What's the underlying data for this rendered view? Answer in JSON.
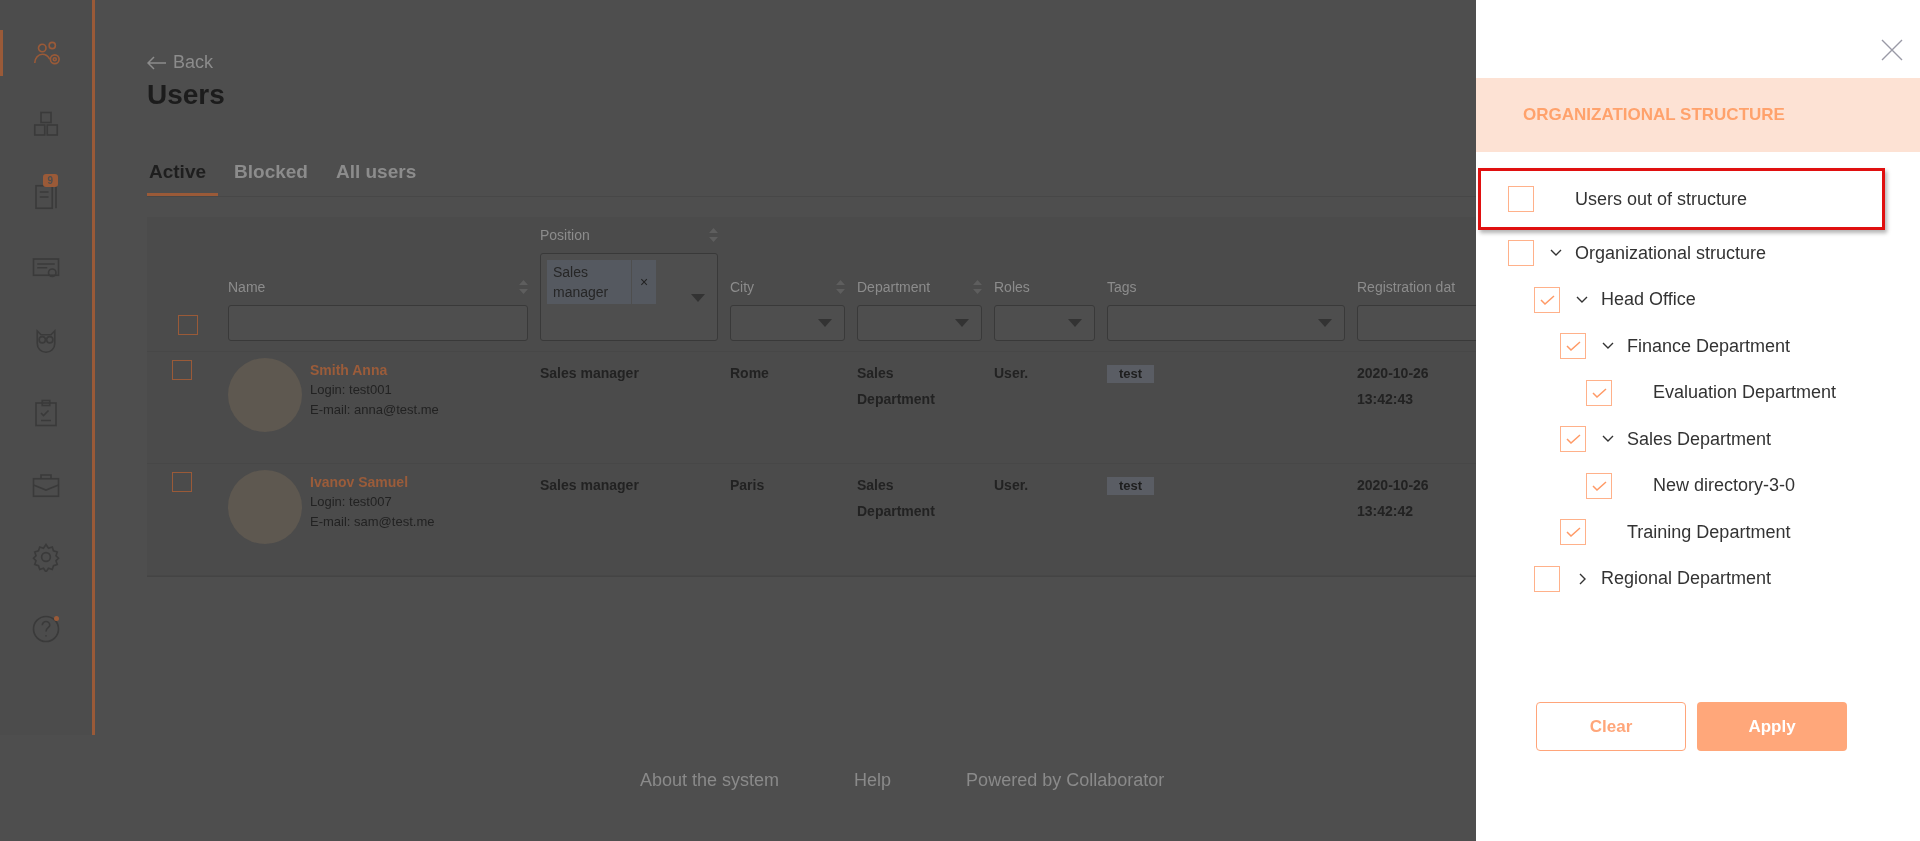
{
  "sidebar": {
    "items": [
      {
        "selected": true
      },
      {
        "selected": false
      },
      {
        "selected": false,
        "badge": "9"
      },
      {
        "selected": false
      },
      {
        "selected": false
      },
      {
        "selected": false
      },
      {
        "selected": false
      },
      {
        "selected": false
      },
      {
        "selected": false,
        "notification_dot": true
      }
    ]
  },
  "back_link": "Back",
  "title": "Users",
  "tabs": [
    {
      "label": "Active",
      "selected": true
    },
    {
      "label": "Blocked",
      "selected": false
    },
    {
      "label": "All users",
      "selected": false
    }
  ],
  "table": {
    "columns": [
      {
        "label": "Name",
        "sortable": true,
        "kind": "text"
      },
      {
        "label": "Position",
        "sortable": true,
        "kind": "multiselect",
        "chips": [
          {
            "label": "Sales manager",
            "remove": "×"
          }
        ]
      },
      {
        "label": "City",
        "sortable": true,
        "kind": "dropdown"
      },
      {
        "label": "Department",
        "sortable": true,
        "kind": "dropdown"
      },
      {
        "label": "Roles",
        "sortable": false,
        "kind": "dropdown"
      },
      {
        "label": "Tags",
        "sortable": false,
        "kind": "dropdown"
      },
      {
        "label": "Registration dat",
        "sortable": false,
        "kind": "text"
      }
    ],
    "select_all_checked": false,
    "rows": [
      {
        "checked": false,
        "name": "Smith Anna",
        "login": "Login: test001",
        "email": "E-mail: anna@test.me",
        "position": "Sales manager",
        "city": "Rome",
        "department": "Sales Department",
        "roles": "User.",
        "tags": [
          "test"
        ],
        "date": "2020-10-26",
        "time": "13:42:43"
      },
      {
        "checked": false,
        "name": "Ivanov Samuel",
        "login": "Login: test007",
        "email": "E-mail: sam@test.me",
        "position": "Sales manager",
        "city": "Paris",
        "department": "Sales Department",
        "roles": "User.",
        "tags": [
          "test"
        ],
        "date": "2020-10-26",
        "time": "13:42:42"
      }
    ]
  },
  "footer": [
    "About the system",
    "Help",
    "Powered by Collaborator"
  ],
  "panel": {
    "title": "ORGANIZATIONAL STRUCTURE",
    "tree": [
      {
        "label": "Users out of structure",
        "checked": false,
        "highlighted": true
      },
      {
        "label": "Organizational structure",
        "checked": false,
        "expanded": true,
        "children": [
          {
            "label": "Head Office",
            "checked": true,
            "expanded": true,
            "children": [
              {
                "label": "Finance Department",
                "checked": true,
                "expanded": true,
                "children": [
                  {
                    "label": "Evaluation Department",
                    "checked": true
                  }
                ]
              },
              {
                "label": "Sales Department",
                "checked": true,
                "expanded": true,
                "children": [
                  {
                    "label": "New directory-3-0",
                    "checked": true
                  }
                ]
              },
              {
                "label": "Training Department",
                "checked": true
              }
            ]
          },
          {
            "label": "Regional Department",
            "checked": false,
            "expanded": false
          }
        ]
      }
    ],
    "buttons": [
      {
        "label": "Clear",
        "kind": "secondary"
      },
      {
        "label": "Apply",
        "kind": "primary"
      }
    ]
  }
}
